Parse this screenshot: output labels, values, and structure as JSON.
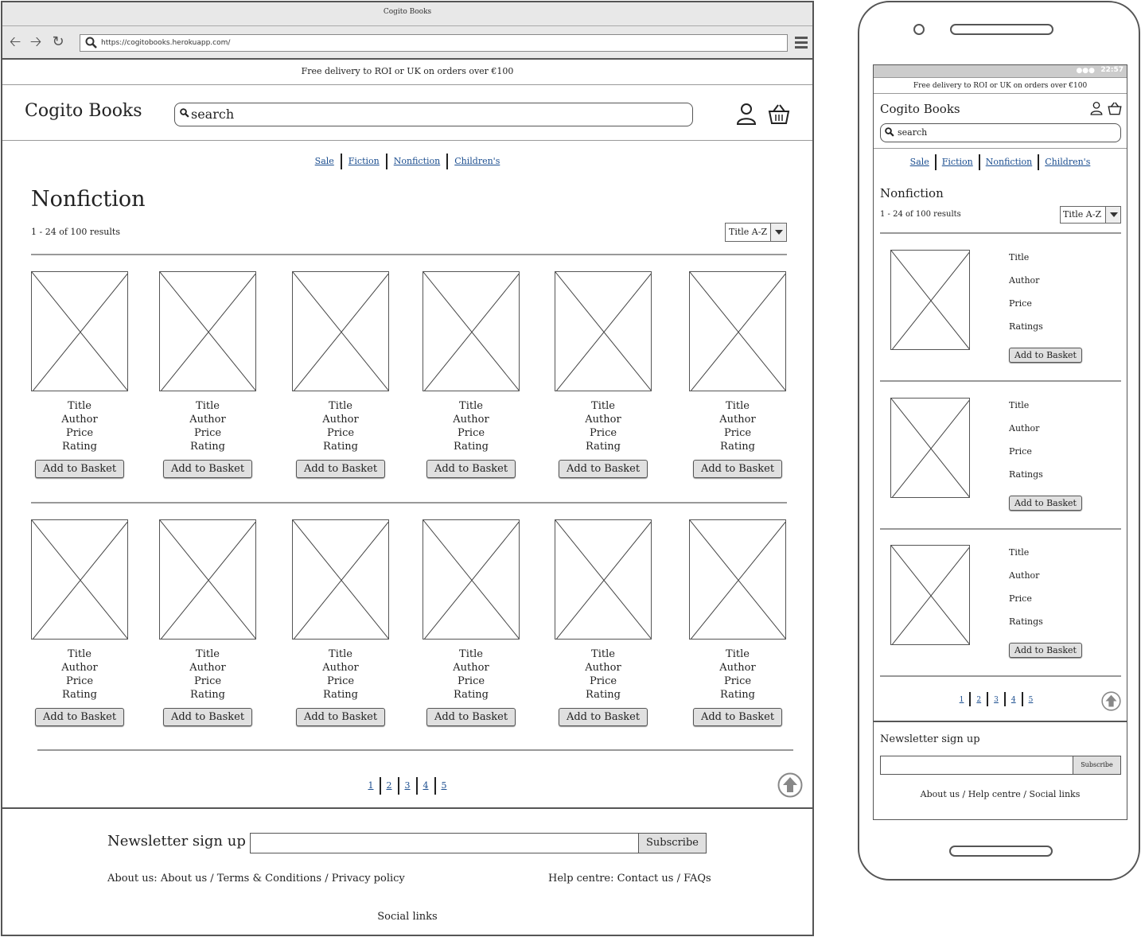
{
  "browser": {
    "window_title": "Cogito Books",
    "url": "https://cogitobooks.herokuapp.com/"
  },
  "promo": "Free delivery to ROI or UK on orders over €100",
  "header": {
    "logo": "Cogito Books",
    "search_placeholder": "search"
  },
  "categories": [
    "Sale",
    "Fiction",
    "Nonfiction",
    "Children's"
  ],
  "page": {
    "title": "Nonfiction",
    "results": "1 - 24 of 100 results",
    "sort": "Title A-Z"
  },
  "product_card": {
    "title": "Title",
    "author": "Author",
    "price": "Price",
    "rating": "Rating",
    "button": "Add to Basket"
  },
  "pagination": [
    "1",
    "2",
    "3",
    "4",
    "5"
  ],
  "footer": {
    "newsletter_label": "Newsletter sign up",
    "subscribe": "Subscribe",
    "about": "About us: About us / Terms & Conditions / Privacy policy",
    "help": "Help centre: Contact us / FAQs",
    "social": "Social links"
  },
  "mobile": {
    "status_time": "22:57",
    "promo": "Free delivery to ROI or UK on orders over €100",
    "logo": "Cogito Books",
    "search_placeholder": "search",
    "title": "Nonfiction",
    "results": "1 - 24 of 100 results",
    "sort": "Title A-Z",
    "item": {
      "title": "Title",
      "author": "Author",
      "price": "Price",
      "ratings": "Ratings",
      "button": "Add to Basket"
    },
    "newsletter_label": "Newsletter sign up",
    "subscribe": "Subscribe",
    "footer_links": "About us / Help centre / Social links"
  }
}
